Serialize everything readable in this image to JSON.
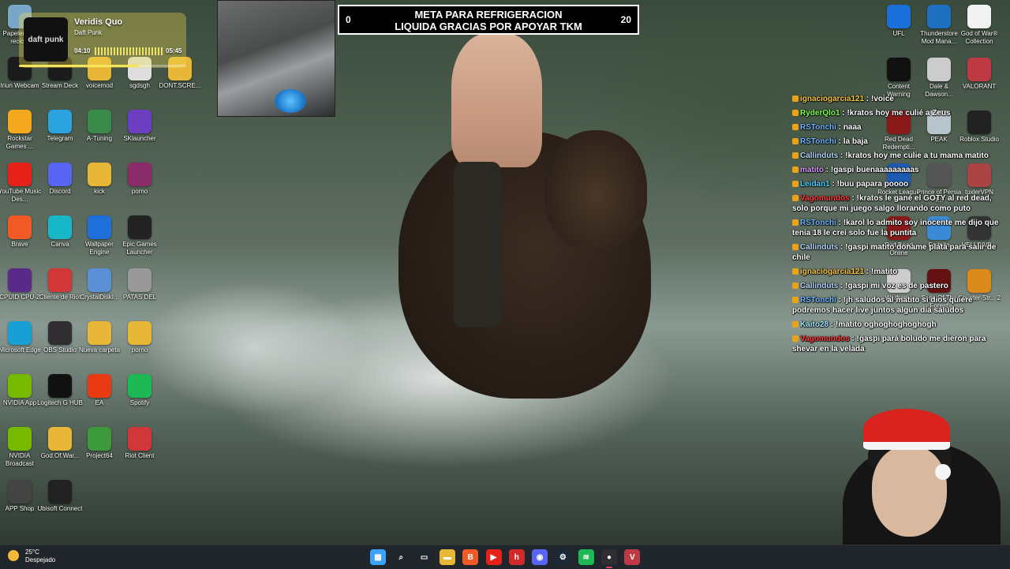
{
  "stream": {
    "goal": {
      "start": "0",
      "end": "20",
      "line1": "META PARA REFRIGERACION",
      "line2": "LIQUIDA GRACIAS POR APOYAR TKM"
    }
  },
  "music": {
    "title": "Veridis Quo",
    "artist": "Daft Punk",
    "elapsed": "04:10",
    "total": "05:45",
    "progress": 0.72,
    "art_text": "daft punk"
  },
  "desktop_icons_left": [
    {
      "label": "Papelera de recic...",
      "icon": "recycle-bin-icon",
      "color": "#7aa6c8"
    },
    {
      "label": "Iriun Webcam",
      "icon": "webcam-icon",
      "color": "#1b1b1b"
    },
    {
      "label": "Stream Deck",
      "icon": "stream-deck-icon",
      "color": "#1b1b1b"
    },
    {
      "label": "voicemod",
      "icon": "folder-icon",
      "color": "#e8b737"
    },
    {
      "label": "sgdsgh",
      "icon": "image-file-icon",
      "color": "#ddd"
    },
    {
      "label": "DONT.SCRE...",
      "icon": "folder-icon",
      "color": "#e8b737"
    },
    {
      "label": "Rockstar Games ...",
      "icon": "rockstar-icon",
      "color": "#f4a81d"
    },
    {
      "label": "Telegram",
      "icon": "telegram-icon",
      "color": "#2aa3df"
    },
    {
      "label": "A-Tuning",
      "icon": "a-tuning-icon",
      "color": "#3a8a4a"
    },
    {
      "label": "SKlauncher",
      "icon": "sklauncher-icon",
      "color": "#6b3fc0"
    },
    {
      "label": "YouTube Music Des...",
      "icon": "youtube-music-icon",
      "color": "#e62117"
    },
    {
      "label": "Discord",
      "icon": "discord-icon",
      "color": "#5865f2"
    },
    {
      "label": "kick",
      "icon": "folder-icon",
      "color": "#e8b737"
    },
    {
      "label": "porno",
      "icon": "winrar-icon",
      "color": "#8a2c6a"
    },
    {
      "label": "Brave",
      "icon": "brave-icon",
      "color": "#f15a24"
    },
    {
      "label": "Canva",
      "icon": "canva-icon",
      "color": "#18b8c9"
    },
    {
      "label": "Wallpaper Engine",
      "icon": "wallpaper-engine-icon",
      "color": "#1e6fd9"
    },
    {
      "label": "Epic Games Launcher",
      "icon": "epic-games-icon",
      "color": "#222"
    },
    {
      "label": "CPUID CPU-Z",
      "icon": "cpuz-icon",
      "color": "#5a2a8a"
    },
    {
      "label": "Cliente de Riot",
      "icon": "riot-icon",
      "color": "#d13639"
    },
    {
      "label": "CrystalDiskI...",
      "icon": "crystaldisk-icon",
      "color": "#5b8fd6"
    },
    {
      "label": "PATAS DEL",
      "icon": "image-file-icon",
      "color": "#999"
    },
    {
      "label": "Microsoft Edge",
      "icon": "edge-icon",
      "color": "#1a9fd4"
    },
    {
      "label": "OBS Studio",
      "icon": "obs-icon",
      "color": "#302e31"
    },
    {
      "label": "Nueva carpeta",
      "icon": "folder-icon",
      "color": "#e8b737"
    },
    {
      "label": "porno",
      "icon": "folder-icon",
      "color": "#e8b737"
    },
    {
      "label": "NVIDIA App",
      "icon": "nvidia-icon",
      "color": "#76b900"
    },
    {
      "label": "Logitech G HUB",
      "icon": "logitech-icon",
      "color": "#111"
    },
    {
      "label": "EA",
      "icon": "ea-icon",
      "color": "#ea3a14"
    },
    {
      "label": "Spotify",
      "icon": "spotify-icon",
      "color": "#1db954"
    },
    {
      "label": "NVIDIA Broadcast",
      "icon": "nvidia-broadcast-icon",
      "color": "#76b900"
    },
    {
      "label": "God.Of.War...",
      "icon": "folder-icon",
      "color": "#e8b737"
    },
    {
      "label": "Project64",
      "icon": "project64-icon",
      "color": "#3c9a3c"
    },
    {
      "label": "Riot Client",
      "icon": "riot-icon",
      "color": "#d13639"
    },
    {
      "label": "APP Shop",
      "icon": "app-shop-icon",
      "color": "#444"
    },
    {
      "label": "Ubisoft Connect",
      "icon": "ubisoft-icon",
      "color": "#222"
    }
  ],
  "desktop_icons_right": [
    {
      "label": "UFL",
      "icon": "ufl-icon",
      "color": "#1a6fd9"
    },
    {
      "label": "Thunderstore Mod Mana...",
      "icon": "thunderstore-icon",
      "color": "#1e6fbf"
    },
    {
      "label": "God of War® Collection",
      "icon": "file-icon",
      "color": "#f2f2f2"
    },
    {
      "label": "Content Warning",
      "icon": "content-warning-icon",
      "color": "#111"
    },
    {
      "label": "Dale & Dawson...",
      "icon": "printer-icon",
      "color": "#ccc"
    },
    {
      "label": "VALORANT",
      "icon": "valorant-icon",
      "color": "#bd3944"
    },
    {
      "label": "Red Dead Redempti...",
      "icon": "rdr-icon",
      "color": "#8a1a1a"
    },
    {
      "label": "PEAK",
      "icon": "peak-icon",
      "color": "#b7c4cc"
    },
    {
      "label": "Roblox Studio",
      "icon": "roblox-icon",
      "color": "#222"
    },
    {
      "label": "Rocket League",
      "icon": "rocket-league-icon",
      "color": "#1c5bb0"
    },
    {
      "label": "Prince of Persia T...",
      "icon": "prince-icon",
      "color": "#555"
    },
    {
      "label": "tuxlerVPN",
      "icon": "tuxler-icon",
      "color": "#a44"
    },
    {
      "label": "Red Dead Online",
      "icon": "rdo-icon",
      "color": "#8a1a1a"
    },
    {
      "label": "Fortnite",
      "icon": "fortnite-icon",
      "color": "#3a8ad6"
    },
    {
      "label": "HELLDIVE...",
      "icon": "helldivers-icon",
      "color": "#333"
    },
    {
      "label": "Warframe",
      "icon": "warframe-icon",
      "color": "#ccc"
    },
    {
      "label": "Sons Of The Forest",
      "icon": "sotf-icon",
      "color": "#611"
    },
    {
      "label": "Counter-Str... 2",
      "icon": "cs2-icon",
      "color": "#d98a1a"
    }
  ],
  "chat": [
    {
      "user": "ignaciogarcia121",
      "color": "#f5c542",
      "text": " : !voice"
    },
    {
      "user": "RyderQlo1",
      "color": "#7dff4a",
      "text": " : !kratos hoy me culié a Zeus"
    },
    {
      "user": "RSTonchi",
      "color": "#6fb7ff",
      "text": " : naaa"
    },
    {
      "user": "RSTonchi",
      "color": "#6fb7ff",
      "text": " : la baja"
    },
    {
      "user": "Callinduts",
      "color": "#b7d9ff",
      "text": " : !kratos hoy me culie a tu mama matito"
    },
    {
      "user": "matito",
      "color": "#d89bff",
      "text": " : !gaspi buenaaaaaaaaas"
    },
    {
      "user": "Leidan1",
      "color": "#4ad1ff",
      "text": " : !buu papara poooo"
    },
    {
      "user": "Vagomundos",
      "color": "#ff3d3d",
      "text": " : !kratos le gané el GOTY al red dead, solo porque mi juego salgo llorando como puto"
    },
    {
      "user": "RSTonchi",
      "color": "#6fb7ff",
      "text": " : !karol lo admito soy inocente me dijo que tenía 18 le creí solo fue la puntita"
    },
    {
      "user": "Callinduts",
      "color": "#b7d9ff",
      "text": " : !gaspi  matito doname plata para salir de chile"
    },
    {
      "user": "ignaciogarcia121",
      "color": "#f5c542",
      "text": " : !matito"
    },
    {
      "user": "Callinduts",
      "color": "#b7d9ff",
      "text": " : !gaspi mi voz es de pastero"
    },
    {
      "user": "RSTonchi",
      "color": "#6fb7ff",
      "text": " : !jh saludos al matito si dios quiere podremos hacer live juntos algún día saludos"
    },
    {
      "user": "Kaito28",
      "color": "#9fe8ff",
      "text": " : !matito oghoghoghoghogh"
    },
    {
      "user": "Vagomundos",
      "color": "#ff3d3d",
      "text": " : !gaspi pará boludo me dieron para shevar en la velada"
    }
  ],
  "taskbar": {
    "weather_temp": "25°C",
    "weather_cond": "Despejado",
    "apps": [
      {
        "icon": "start-icon",
        "color": "#3aa3ff",
        "glyph": "▦"
      },
      {
        "icon": "search-icon",
        "color": "transparent",
        "glyph": "⌕"
      },
      {
        "icon": "task-view-icon",
        "color": "transparent",
        "glyph": "▭"
      },
      {
        "icon": "file-explorer-icon",
        "color": "#e8b737",
        "glyph": "▬"
      },
      {
        "icon": "brave-icon",
        "color": "#f15a24",
        "glyph": "B"
      },
      {
        "icon": "youtube-music-icon",
        "color": "#e62117",
        "glyph": "▶"
      },
      {
        "icon": "app-red-icon",
        "color": "#d12a2a",
        "glyph": "h"
      },
      {
        "icon": "discord-icon",
        "color": "#5865f2",
        "glyph": "◉"
      },
      {
        "icon": "steam-icon",
        "color": "#1b2838",
        "glyph": "⚙"
      },
      {
        "icon": "spotify-icon",
        "color": "#1db954",
        "glyph": "≋"
      },
      {
        "icon": "obs-icon",
        "color": "#302e31",
        "glyph": "●"
      },
      {
        "icon": "valorant-icon",
        "color": "#bd3944",
        "glyph": "V"
      }
    ]
  }
}
